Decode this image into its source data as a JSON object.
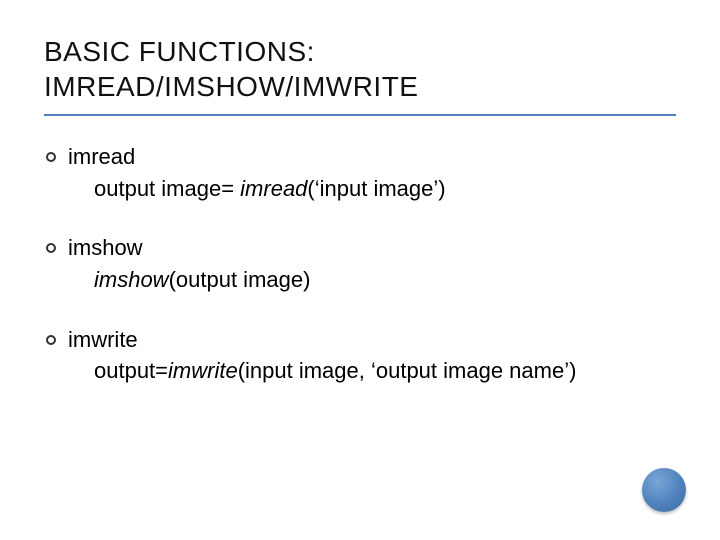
{
  "title_line1": "BASIC FUNCTIONS:",
  "title_line2": "IMREAD/IMSHOW/IMWRITE",
  "items": [
    {
      "name": "imread",
      "pre": "output image= ",
      "func": "imread",
      "post": "(‘input image’)"
    },
    {
      "name": "imshow",
      "pre": "",
      "func": "imshow",
      "post": "(output image)"
    },
    {
      "name": "imwrite",
      "pre": "output=",
      "func": "imwrite",
      "post": "(input image, ‘output image name’)"
    }
  ]
}
